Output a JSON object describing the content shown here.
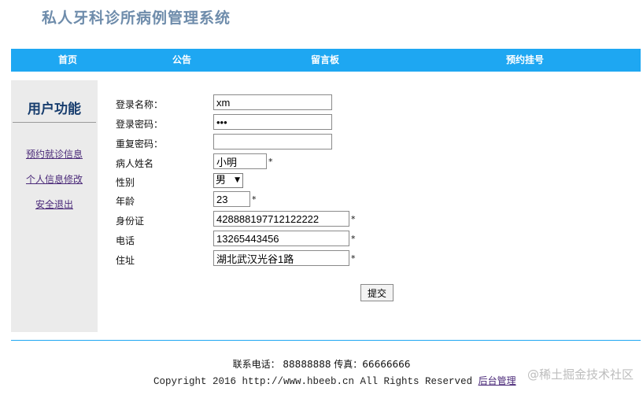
{
  "header": {
    "title": "私人牙科诊所病例管理系统"
  },
  "nav": {
    "items": [
      {
        "label": "首页"
      },
      {
        "label": "公告"
      },
      {
        "label": "留言板"
      },
      {
        "label": "预约挂号"
      }
    ]
  },
  "sidebar": {
    "title": "用户功能",
    "links": [
      {
        "label": "预约就诊信息"
      },
      {
        "label": "个人信息修改"
      },
      {
        "label": "安全退出"
      }
    ]
  },
  "form": {
    "username": {
      "label": "登录名称：",
      "value": "xm"
    },
    "password": {
      "label": "登录密码：",
      "value": "xyz"
    },
    "confirm": {
      "label": "重复密码：",
      "value": ""
    },
    "name": {
      "label": "病人姓名",
      "value": "小明",
      "required": "*"
    },
    "gender": {
      "label": "性别",
      "value": "男"
    },
    "age": {
      "label": "年龄",
      "value": "23",
      "required": "*"
    },
    "id_card": {
      "label": "身份证",
      "value": "428888197712122222",
      "required": "*"
    },
    "phone": {
      "label": "电话",
      "value": "13265443456",
      "required": "*"
    },
    "address": {
      "label": "住址",
      "value": "湖北武汉光谷1路",
      "required": "*"
    },
    "submit_label": "提交"
  },
  "footer": {
    "contact": "联系电话： 88888888 传真：66666666",
    "copyright": "Copyright 2016 http://www.hbeeb.cn All Rights Reserved",
    "admin_link": "后台管理",
    "watermark": "@稀土掘金技术社区"
  },
  "colors": {
    "nav_bg": "#1ea7f2",
    "title": "#6e8cab",
    "sidebar_bg": "#ebebeb",
    "sidebar_title": "#173d6e",
    "link": "#4b2a79"
  }
}
